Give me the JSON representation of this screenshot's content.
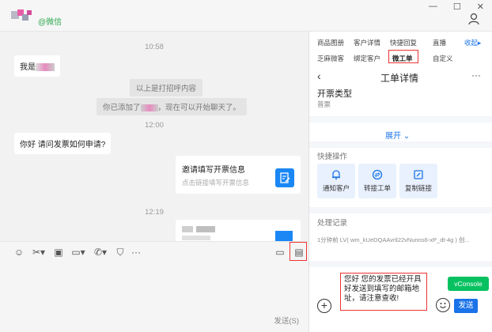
{
  "header": {
    "contact_source": "@微信",
    "user_icon": "user-icon"
  },
  "chat": {
    "time1": "10:58",
    "msg_contact_name": "我是",
    "sys_msg1": "以上是打招呼内容",
    "sys_msg2_prefix": "你已添加了",
    "sys_msg2_suffix": "，现在可以开始聊天了。",
    "time2": "12:00",
    "msg_question": "你好 请问发票如何申请?",
    "card_title": "邀请填写开票信息",
    "card_subtitle": "点击链接填写开票信息",
    "card_icon": "edit-doc-icon",
    "time3": "12:19"
  },
  "toolbar": {
    "icons": [
      "smile-icon",
      "scissors-icon",
      "image-icon",
      "folder-icon",
      "phone-icon",
      "shield-icon",
      "more-icon",
      "screen-icon",
      "worksheet-icon"
    ],
    "send_label": "发送(S)"
  },
  "panel": {
    "tabs_row1": [
      "商品图册",
      "客户详情",
      "快捷回复",
      "直播",
      "收起"
    ],
    "tabs_row2": [
      "乏麻微客",
      "绑定客户",
      "微工单",
      "自定义"
    ],
    "active_tab": "微工单",
    "detail_title": "工单详情",
    "field_label": "开票类型",
    "field_value": "普票",
    "expand_label": "展开",
    "quick_ops_title": "快捷操作",
    "quick_ops": [
      {
        "label": "通知客户",
        "icon": "bell-icon"
      },
      {
        "label": "转接工单",
        "icon": "transfer-icon"
      },
      {
        "label": "复制链接",
        "icon": "copy-link-icon"
      }
    ],
    "records_title": "处理记录",
    "record_line": "1分钟前 LV( wm_kUeDQAAvrli22vNunns6-xP_dt-4g ) 创...",
    "reply_text": "您好 您的发票已经开具好发送到填写的邮箱地址，请注意查收!",
    "vconsole_label": "vConsole",
    "send_button": "发送",
    "accent_color": "#1a73e8",
    "highlight_color": "#ee3333"
  }
}
